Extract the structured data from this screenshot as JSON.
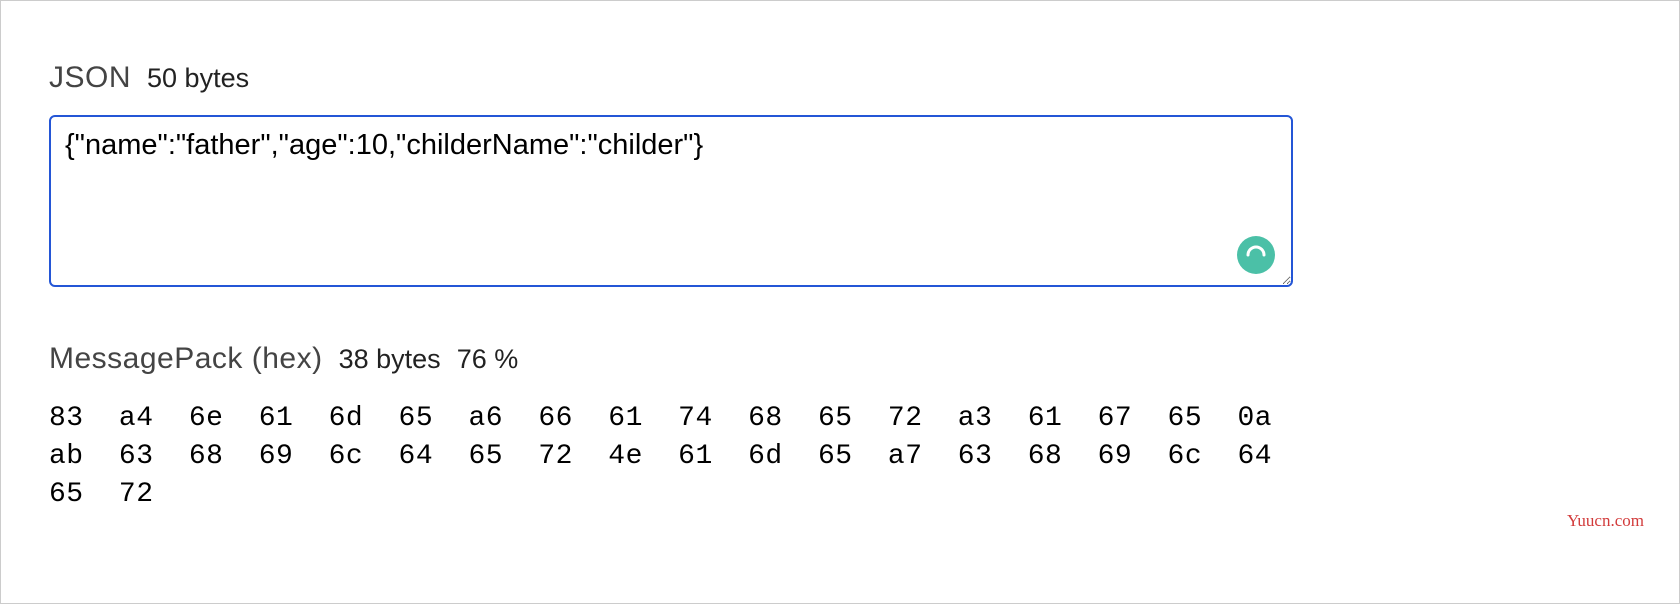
{
  "json_section": {
    "label": "JSON",
    "bytes": "50 bytes",
    "value": "{\"name\":\"father\",\"age\":10,\"childerName\":\"childer\"}"
  },
  "msgpack_section": {
    "label": "MessagePack (hex)",
    "bytes": "38 bytes",
    "percent": "76 %",
    "hex": "83 a4 6e 61 6d 65 a6 66 61 74 68 65 72 a3 61 67 65 0a ab 63 68 69 6c 64 65 72 4e 61 6d 65 a7 63 68 69 6c 64 65 72"
  },
  "watermark": "Yuucn.com"
}
